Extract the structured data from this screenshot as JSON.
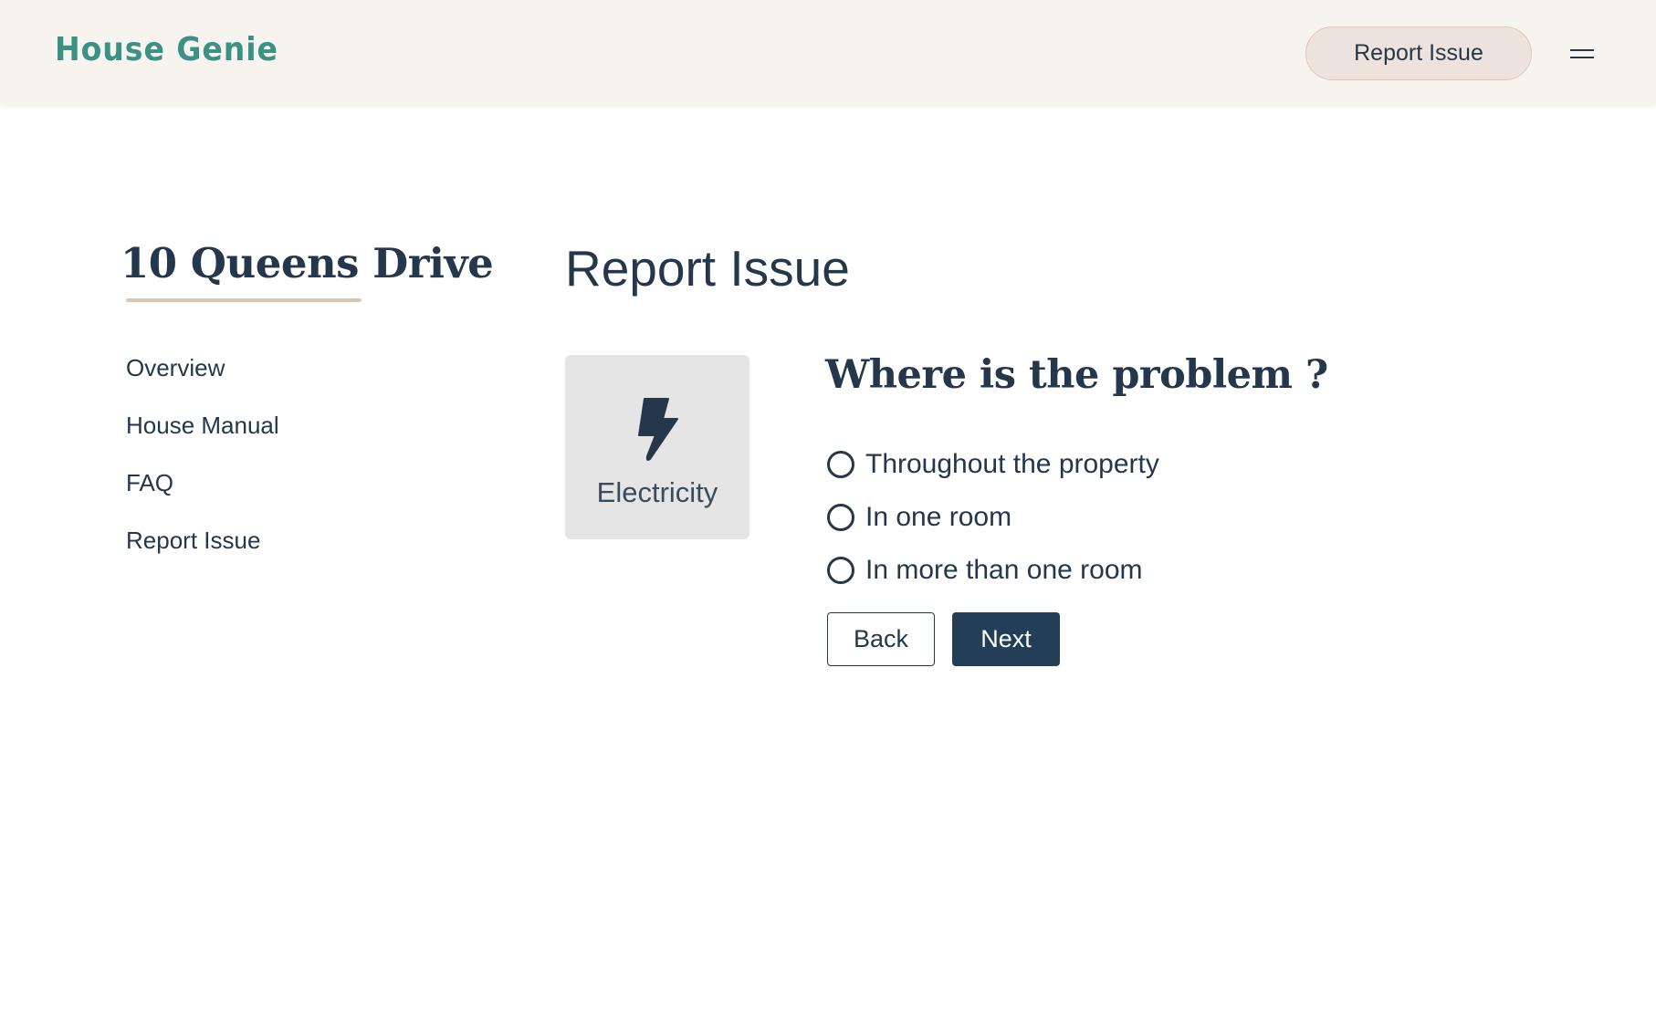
{
  "header": {
    "brand": "House Genie",
    "report_issue_button": "Report Issue",
    "menu_icon": "hamburger-menu-icon"
  },
  "sidebar": {
    "property_name": "10 Queens Drive",
    "items": [
      {
        "label": "Overview"
      },
      {
        "label": "House Manual"
      },
      {
        "label": "FAQ"
      },
      {
        "label": "Report Issue"
      }
    ]
  },
  "main": {
    "heading": "Report Issue",
    "category": {
      "label": "Electricity",
      "icon": "lightning-bolt-icon"
    },
    "question": "Where is the problem ?",
    "options": [
      {
        "label": "Throughout the property",
        "selected": false
      },
      {
        "label": "In one room",
        "selected": false
      },
      {
        "label": "In more than one room",
        "selected": false
      }
    ],
    "back_button": "Back",
    "next_button": "Next"
  },
  "colors": {
    "brand": "#3a9184",
    "header_bg": "#f7f3ef",
    "text": "#25374b",
    "primary_button": "#233f58",
    "pill_bg": "#eee3dc",
    "accent_underline": "#d9c6b5",
    "card_bg": "#e5e5e5"
  }
}
